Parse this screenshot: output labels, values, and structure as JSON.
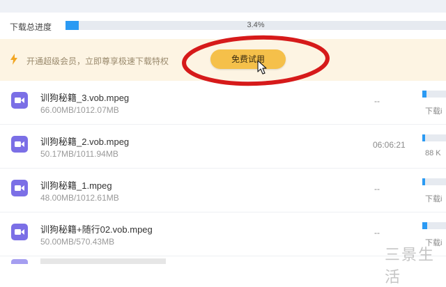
{
  "progress": {
    "label": "下载总进度",
    "percent_text": "3.4%",
    "percent": 3.4
  },
  "promo": {
    "text": "开通超级会员，立即尊享极速下载特权",
    "button_label": "免费试用",
    "icon": "lightning-icon"
  },
  "files": [
    {
      "name": "训狗秘籍_3.vob.mpeg",
      "size": "66.00MB/1012.07MB",
      "time": "--",
      "status": "下载i",
      "progress": 6.5
    },
    {
      "name": "训狗秘籍_2.vob.mpeg",
      "size": "50.17MB/1011.94MB",
      "time": "06:06:21",
      "status": "88 K",
      "progress": 5.0
    },
    {
      "name": "训狗秘籍_1.mpeg",
      "size": "48.00MB/1012.61MB",
      "time": "--",
      "status": "下载i",
      "progress": 4.7
    },
    {
      "name": "训狗秘籍+随行02.vob.mpeg",
      "size": "50.00MB/570.43MB",
      "time": "--",
      "status": "下载i",
      "progress": 8.8
    }
  ],
  "watermark": "三景生活",
  "colors": {
    "accent": "#2b9af3",
    "promo_bg": "#fdf4e3",
    "button": "#f5c04a",
    "annotation": "#d61a1a",
    "file_icon": "#7b6fe6"
  }
}
